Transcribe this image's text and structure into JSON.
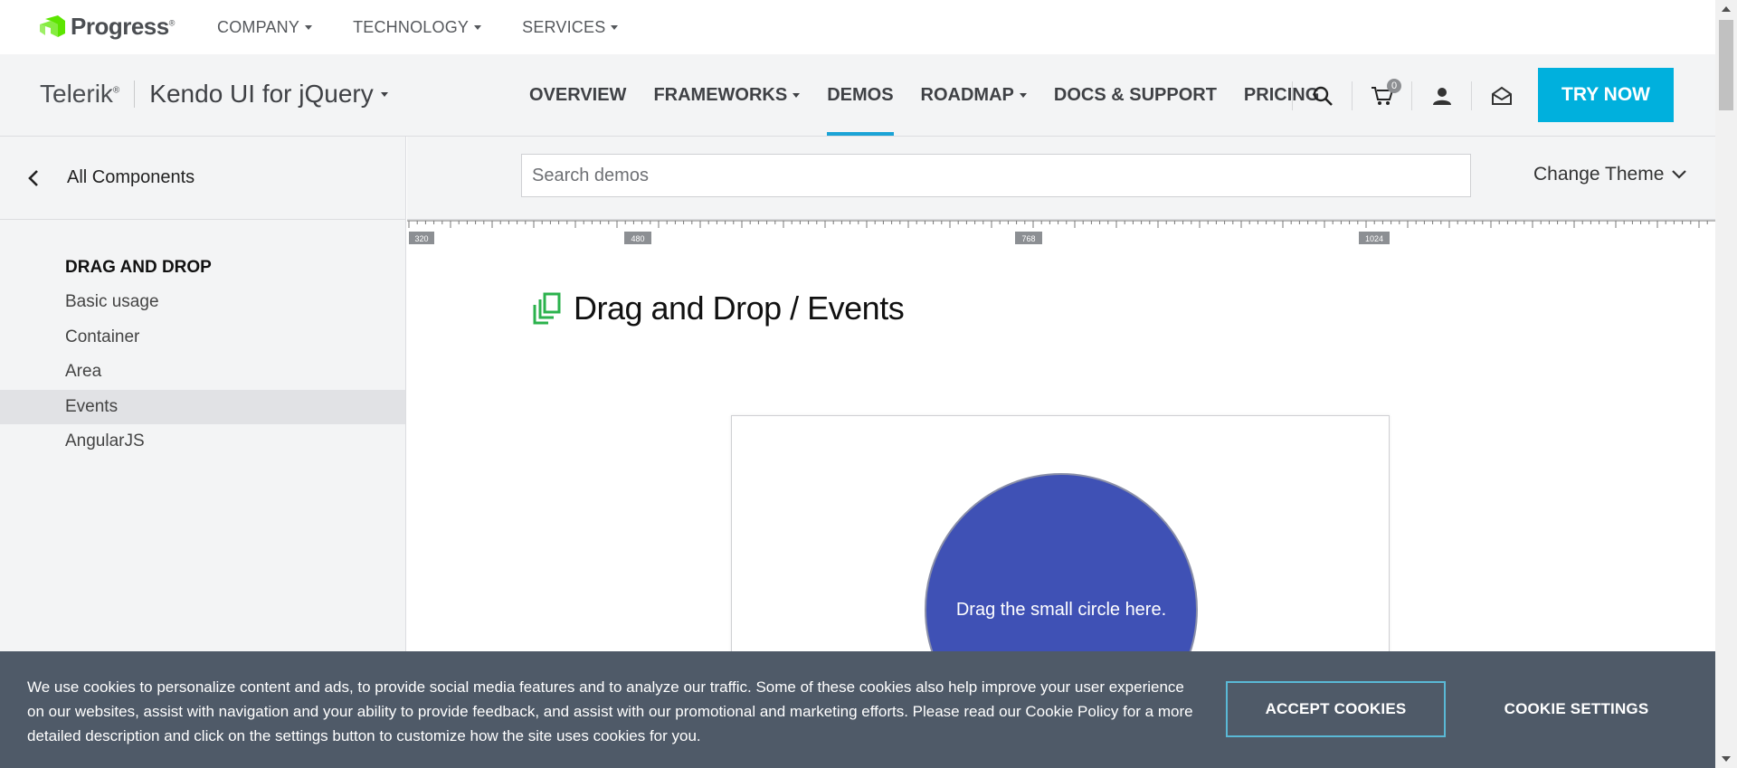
{
  "topbar": {
    "logo_text": "Progress",
    "logo_reg": "®",
    "nav": [
      {
        "label": "COMPANY"
      },
      {
        "label": "TECHNOLOGY"
      },
      {
        "label": "SERVICES"
      }
    ]
  },
  "productbar": {
    "brand": "Telerik",
    "brand_reg": "®",
    "product": "Kendo UI for jQuery",
    "nav": [
      {
        "label": "OVERVIEW"
      },
      {
        "label": "FRAMEWORKS"
      },
      {
        "label": "DEMOS"
      },
      {
        "label": "ROADMAP"
      },
      {
        "label": "DOCS & SUPPORT"
      },
      {
        "label": "PRICING"
      }
    ],
    "cart_count": "0",
    "try_now": "TRY NOW",
    "accent_color": "#00b0dd"
  },
  "sidebar": {
    "back_label": "All Components",
    "section_title": "DRAG AND DROP",
    "items": [
      {
        "label": "Basic usage"
      },
      {
        "label": "Container"
      },
      {
        "label": "Area"
      },
      {
        "label": "Events"
      },
      {
        "label": "AngularJS"
      }
    ]
  },
  "search": {
    "placeholder": "Search demos"
  },
  "theme": {
    "label": "Change Theme"
  },
  "ruler": {
    "marks": [
      "320",
      "480",
      "768",
      "1024"
    ]
  },
  "page": {
    "title": "Drag and Drop / Events"
  },
  "demo": {
    "drop_text": "Drag the small circle here.",
    "circle_color": "#3f51b5"
  },
  "cookie": {
    "text": "We use cookies to personalize content and ads, to provide social media features and to analyze our traffic. Some of these cookies also help improve your user experience on our websites, assist with navigation and your ability to provide feedback, and assist with our promotional and marketing efforts. Please read our Cookie Policy for a more detailed description and click on the settings button to customize how the site uses cookies for you.",
    "accept": "ACCEPT COOKIES",
    "settings": "COOKIE SETTINGS"
  }
}
